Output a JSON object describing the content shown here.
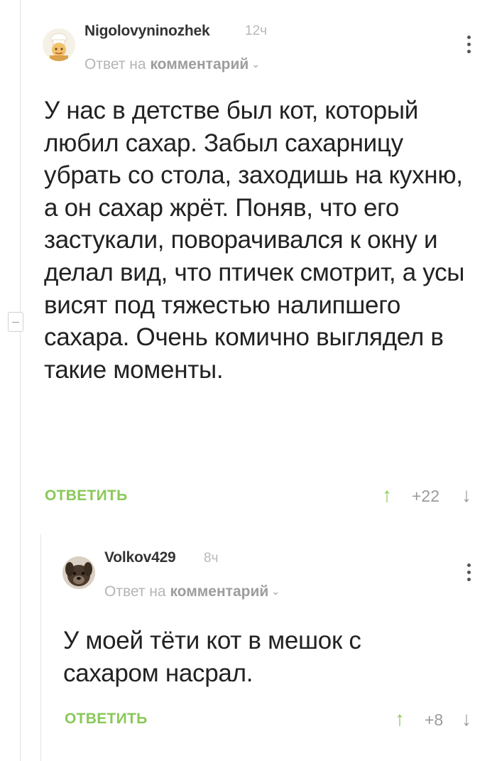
{
  "comments": [
    {
      "username": "Nigolovyninozhek",
      "time": "12ч",
      "reply_prefix": "Ответ на",
      "reply_target": "комментарий",
      "text": "У нас в детстве был кот, который любил сахар. Забыл сахарницу убрать со стола, заходишь на кухню, а он сахар жрёт. Поняв, что его застукали, поворачивался к окну и делал вид, что птичек смотрит, а усы висят под тяжестью налипшего сахара. Очень комично выглядел в такие моменты.",
      "reply_label": "ОТВЕТИТЬ",
      "rating": "+22",
      "avatar_icon": "chef-avatar-icon"
    },
    {
      "username": "Volkov429",
      "time": "8ч",
      "reply_prefix": "Ответ на",
      "reply_target": "комментарий",
      "text": "У моей тёти кот в мешок с сахаром насрал.",
      "reply_label": "ОТВЕТИТЬ",
      "rating": "+8",
      "avatar_icon": "dog-avatar-icon"
    }
  ],
  "icons": {
    "collapse": "collapse-thread-icon",
    "menu": "more-vertical-icon",
    "upvote": "arrow-up-icon",
    "downvote": "arrow-down-icon",
    "chevron": "chevron-down-icon"
  },
  "colors": {
    "accent_green": "#8ac858",
    "meta_gray": "#b5b5b5",
    "text": "#222222"
  }
}
